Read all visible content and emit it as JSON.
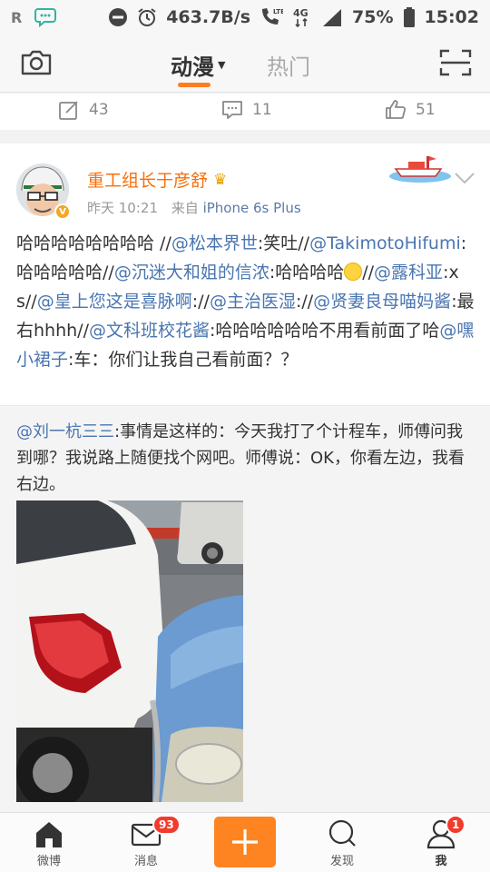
{
  "status_bar": {
    "carrier_letter": "R",
    "speed": "463.7B/s",
    "network": "4G",
    "battery": "75%",
    "time": "15:02"
  },
  "top_nav": {
    "tab_active": "动漫",
    "tab_other": "热门"
  },
  "prev_post_actions": {
    "repost_count": "43",
    "comment_count": "11",
    "like_count": "51"
  },
  "post": {
    "username": "重工组长于彦舒",
    "time": "昨天 10:21",
    "source_prefix": "来自",
    "source": "iPhone 6s Plus",
    "segments": [
      {
        "t": "哈哈哈哈哈哈哈哈 //",
        "m": false
      },
      {
        "t": "@松本界世",
        "m": true
      },
      {
        "t": ":笑吐//",
        "m": false
      },
      {
        "t": "@TakimotoHifumi",
        "m": true
      },
      {
        "t": ":哈哈哈哈哈//",
        "m": false
      },
      {
        "t": "@沉迷大和姐的信浓",
        "m": true
      },
      {
        "t": ":哈哈哈哈",
        "m": false
      },
      {
        "t": "@emoji",
        "m": false,
        "emoji": true
      },
      {
        "t": "//",
        "m": false
      },
      {
        "t": "@露科亚",
        "m": true
      },
      {
        "t": ":xs//",
        "m": false
      },
      {
        "t": "@皇上您这是喜脉啊",
        "m": true
      },
      {
        "t": "://",
        "m": false
      },
      {
        "t": "@主治医湿",
        "m": true
      },
      {
        "t": "://",
        "m": false
      },
      {
        "t": "@贤妻良母喵妈酱",
        "m": true
      },
      {
        "t": ":最右hhhh//",
        "m": false
      },
      {
        "t": "@文科班校花酱",
        "m": true
      },
      {
        "t": ":哈哈哈哈哈哈不用看前面了哈",
        "m": false
      },
      {
        "t": "@嘿小裙子",
        "m": true
      },
      {
        "t": ":车：你们让我自己看前面？？",
        "m": false
      }
    ]
  },
  "retweet": {
    "author": "@刘一杭三三",
    "text": ":事情是这样的：今天我打了个计程车，师傅问我到哪？我说路上随便找个网吧。师傅说：OK，你看左边，我看右边。"
  },
  "tab_bar": {
    "weibo": "微博",
    "messages": "消息",
    "messages_badge": "93",
    "discover": "发现",
    "me": "我",
    "me_badge": "1"
  },
  "colors": {
    "accent_orange": "#fe8421",
    "username_orange": "#f76e0a",
    "link_blue": "#4a75b0",
    "badge_red": "#f23b2c"
  }
}
